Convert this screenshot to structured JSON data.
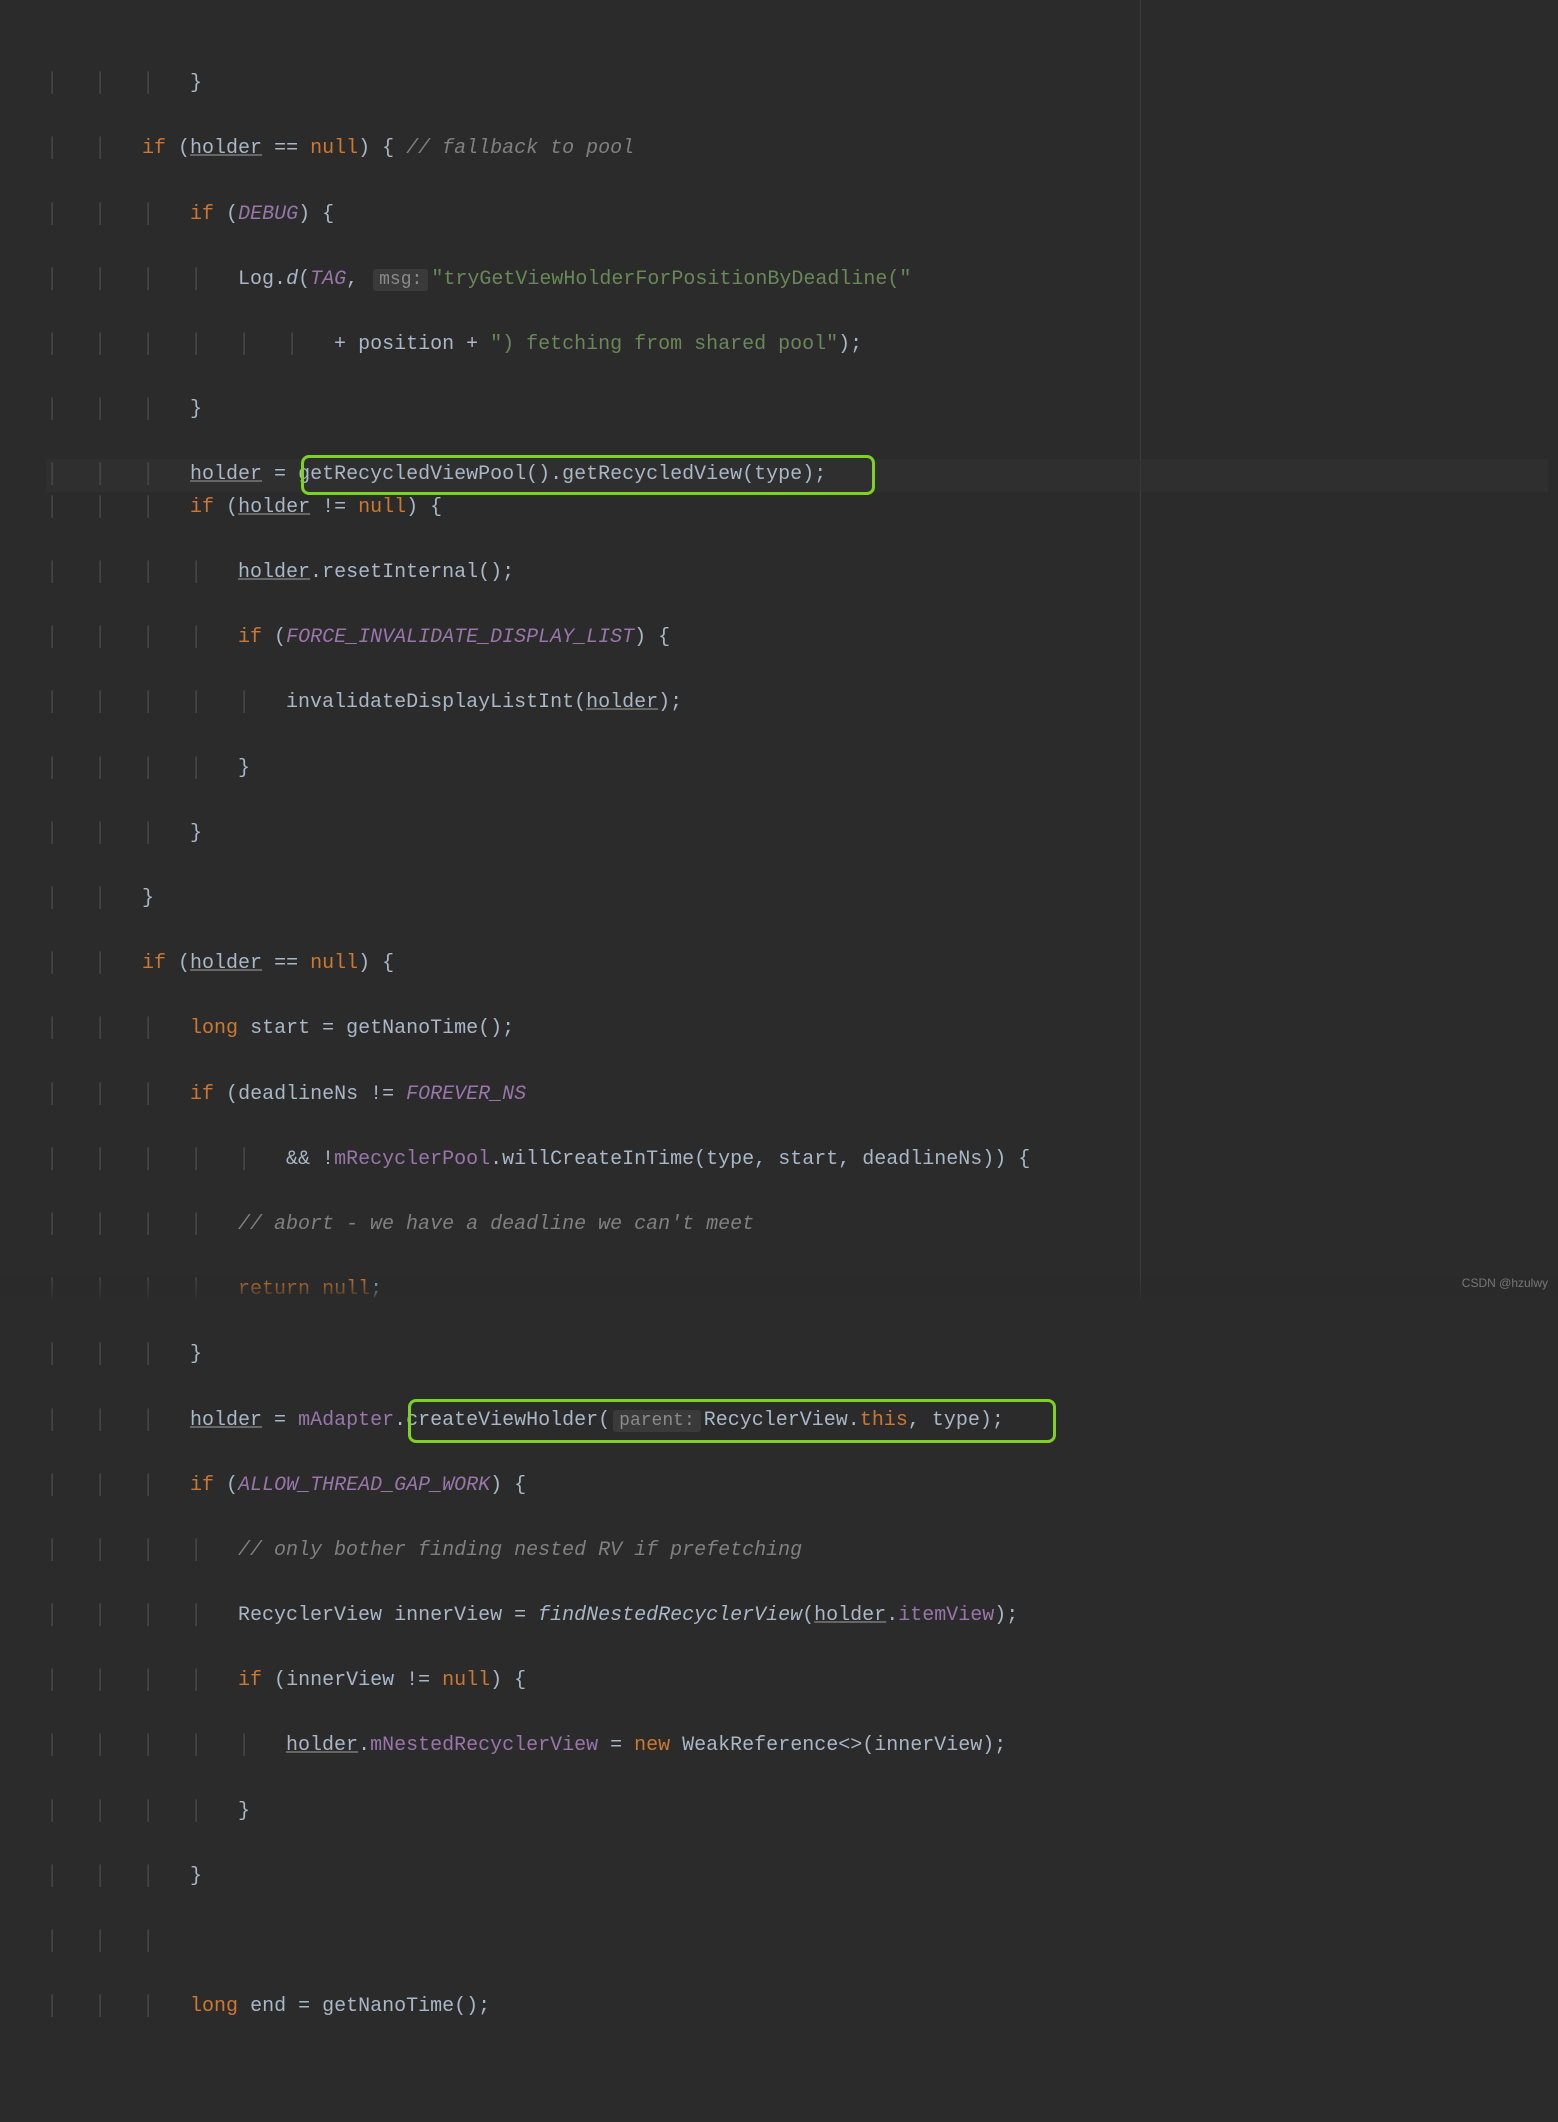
{
  "watermark": "CSDN @hzulwy",
  "code": {
    "l0": "}",
    "l1": {
      "if": "if",
      "open": " (",
      "holder": "holder",
      "eq": " == ",
      "null": "null",
      "close": ") { ",
      "comment": "// fallback to pool"
    },
    "l2": {
      "if": "if",
      "open": " (",
      "debug": "DEBUG",
      "close": ") {"
    },
    "l3": {
      "log": "Log",
      "dot": ".",
      "d": "d",
      "open": "(",
      "tag": "TAG",
      "comma": ", ",
      "msgLabel": "msg:",
      "str": "\"tryGetViewHolderForPositionByDeadline(\""
    },
    "l4": {
      "plus1": "+ ",
      "pos": "position ",
      "plus2": "+ ",
      "str": "\") fetching from shared pool\"",
      "close": ");"
    },
    "l5": "}",
    "l6": {
      "holder": "holder",
      "eq": " = ",
      "m1": "getRecycledViewPool",
      "p1": "().",
      "m2": "getRecycledView",
      "p2": "(",
      "type": "type",
      "p3": ");"
    },
    "l7": {
      "if": "if",
      "open": " (",
      "holder": "holder",
      "ne": " != ",
      "null": "null",
      "close": ") {"
    },
    "l8": {
      "holder": "holder",
      "dot": ".",
      "m": "resetInternal",
      "p": "();"
    },
    "l9": {
      "if": "if",
      "open": " (",
      "const": "FORCE_INVALIDATE_DISPLAY_LIST",
      "close": ") {"
    },
    "l10": {
      "m": "invalidateDisplayListInt",
      "open": "(",
      "holder": "holder",
      "close": ");"
    },
    "l11": "}",
    "l12": "}",
    "l13": "}",
    "l14": {
      "if": "if",
      "open": " (",
      "holder": "holder",
      "eq": " == ",
      "null": "null",
      "close": ") {"
    },
    "l15": {
      "long": "long",
      "sp": " ",
      "start": "start",
      "eq": " = ",
      "m": "getNanoTime",
      "p": "();"
    },
    "l16": {
      "if": "if",
      "open": " (",
      "dn": "deadlineNs",
      "ne": " != ",
      "const": "FOREVER_NS"
    },
    "l17": {
      "and": "&& !",
      "pool": "mRecyclerPool",
      "dot": ".",
      "m": "willCreateInTime",
      "open": "(",
      "type": "type",
      "c1": ", ",
      "start": "start",
      "c2": ", ",
      "dn": "deadlineNs",
      "close": ")) {"
    },
    "l18": "// abort - we have a deadline we can't meet",
    "l19": {
      "return": "return",
      "sp": " ",
      "null": "null",
      "semi": ";"
    },
    "l20": "}",
    "l21": {
      "holder": "holder",
      "eq": " = ",
      "adapter": "mAdapter",
      "dot": ".",
      "m": "createViewHolder",
      "open": "(",
      "parentLabel": "parent:",
      "rv": "RecyclerView",
      "dot2": ".",
      "this": "this",
      "c": ", ",
      "type": "type",
      "close": ");"
    },
    "l22": {
      "if": "if",
      "open": " (",
      "const": "ALLOW_THREAD_GAP_WORK",
      "close": ") {"
    },
    "l23": "// only bother finding nested RV if prefetching",
    "l24": {
      "type": "RecyclerView ",
      "var": "innerView",
      "eq": " = ",
      "m": "findNestedRecyclerView",
      "open": "(",
      "holder": "holder",
      "dot": ".",
      "field": "itemView",
      "close": ");"
    },
    "l25": {
      "if": "if",
      "open": " (",
      "var": "innerView",
      "ne": " != ",
      "null": "null",
      "close": ") {"
    },
    "l26": {
      "holder": "holder",
      "dot": ".",
      "field": "mNestedRecyclerView",
      "eq": " = ",
      "new": "new",
      "sp": " ",
      "cls": "WeakReference<>",
      "open": "(",
      "var": "innerView",
      "close": ");"
    },
    "l27": "}",
    "l28": "}",
    "l30": {
      "long": "long",
      "sp": " ",
      "end": "end",
      "eq": " = ",
      "m": "getNanoTime",
      "p": "();"
    }
  }
}
